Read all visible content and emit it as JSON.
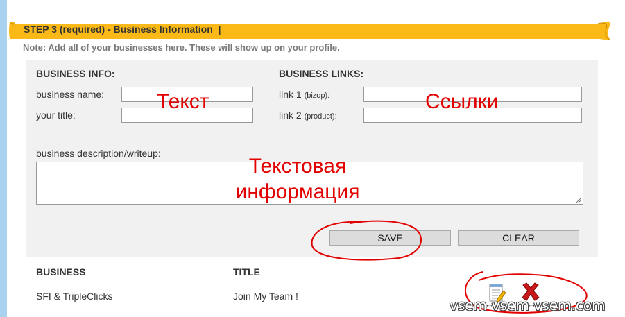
{
  "banner": {
    "title": "STEP 3 (required) - Business Information  |"
  },
  "note": "Note: Add all of your businesses here. These will show up on your profile.",
  "business_info": {
    "heading": "BUSINESS INFO:",
    "name_label": "business name:",
    "name_value": "",
    "title_label": "your title:",
    "title_value": ""
  },
  "business_links": {
    "heading": "BUSINESS LINKS:",
    "link1_label": "link 1",
    "link1_hint": "(bizop):",
    "link1_value": "",
    "link2_label": "link 2",
    "link2_hint": "(product):",
    "link2_value": ""
  },
  "description": {
    "label": "business description/writeup:",
    "value": ""
  },
  "buttons": {
    "save": "SAVE",
    "clear": "CLEAR"
  },
  "table": {
    "headers": [
      "BUSINESS",
      "TITLE"
    ],
    "rows": [
      {
        "business": "SFI & TripleClicks",
        "title": "Join My Team !"
      }
    ]
  },
  "annotations": {
    "text": "Текст",
    "links": "Ссылки",
    "info_line1": "Текстовая",
    "info_line2": "информация"
  },
  "watermark": "vsem-vsem-vsem.com",
  "colors": {
    "banner": "#fbb917",
    "panel": "#f1f1f1",
    "annotation": "#e20000",
    "left_stripe": "#a9d2f1"
  },
  "icons": {
    "edit": "edit-notepad-icon",
    "delete": "delete-x-icon"
  }
}
